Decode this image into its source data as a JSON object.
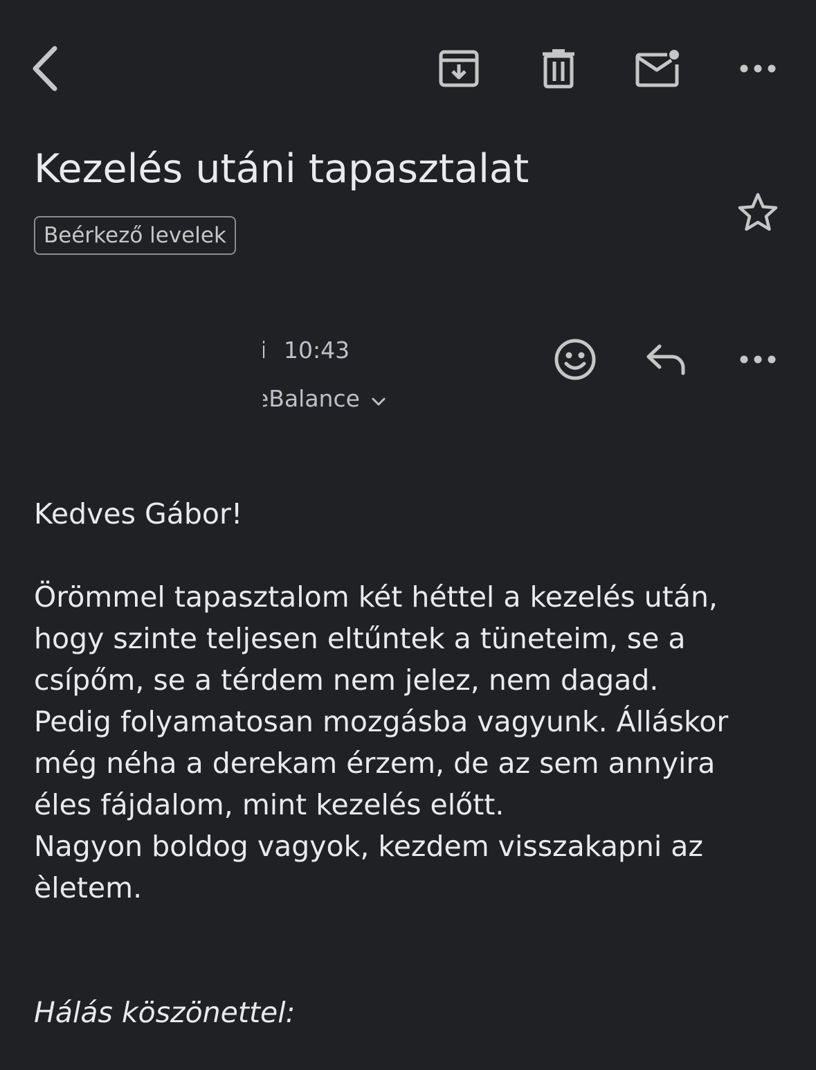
{
  "toolbar": {
    "back_icon": "chevron-left-icon",
    "archive_icon": "archive-icon",
    "delete_icon": "trash-icon",
    "mark_unread_icon": "mail-unread-icon",
    "more_icon": "more-horizontal-icon"
  },
  "email": {
    "subject": "Kezelés utáni tapasztalat",
    "label": "Beérkező levelek",
    "sender_fragment": "i",
    "time": "10:43",
    "recipient": "eBalance",
    "starred": false
  },
  "message_actions": {
    "emoji_icon": "emoji-smile-icon",
    "reply_icon": "reply-icon",
    "more_icon": "more-horizontal-icon"
  },
  "body": {
    "greeting": "Kedves Gábor!",
    "lines": [
      "Örömmel tapasztalom két héttel a kezelés után,",
      "hogy szinte teljesen eltűntek a tüneteim, se a",
      "csípőm, se a térdem nem jelez, nem dagad.",
      "Pedig folyamatosan mozgásba vagyunk. Álláskor",
      "még néha a derekam érzem, de az sem annyira",
      "éles fájdalom, mint kezelés előtt.",
      "Nagyon boldog vagyok, kezdem visszakapni az",
      "èletem."
    ],
    "sign_off": "Hálás köszönettel:"
  },
  "colors": {
    "background": "#202124",
    "text_primary": "#e8eaed",
    "text_secondary": "#bdc1c6",
    "icon": "#c4c7c5"
  }
}
